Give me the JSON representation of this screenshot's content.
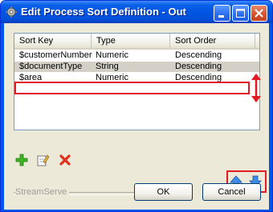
{
  "window": {
    "title": "Edit Process Sort Definition - Out"
  },
  "list": {
    "columns": [
      "Sort Key",
      "Type",
      "Sort Order"
    ],
    "rows": [
      {
        "key": "$customerNumber",
        "type": "Numeric",
        "order": "Descending"
      },
      {
        "key": "$documentType",
        "type": "String",
        "order": "Descending"
      },
      {
        "key": "$area",
        "type": "Numeric",
        "order": "Descending"
      }
    ],
    "selected_index": 1
  },
  "toolbar": {
    "icons": [
      "add-icon",
      "edit-icon",
      "delete-icon",
      "move-up-icon",
      "move-down-icon"
    ]
  },
  "footer": {
    "brand": "StreamServe",
    "ok_label": "OK",
    "cancel_label": "Cancel"
  },
  "colors": {
    "annotation_red": "#e21b23",
    "titlebar_blue": "#0255e3",
    "dialog_bg": "#ece9d8"
  }
}
